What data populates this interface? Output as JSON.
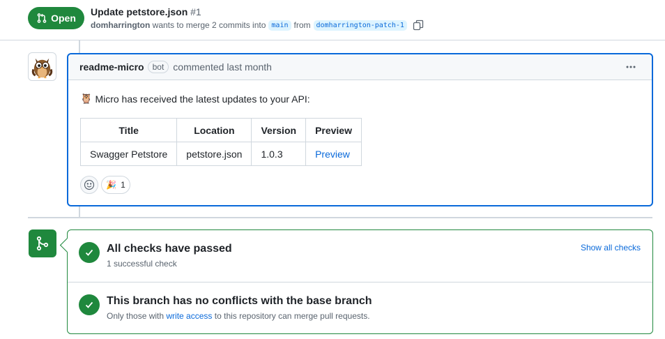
{
  "header": {
    "state_label": "Open",
    "title": "Update petstore.json",
    "number": "#1",
    "author": "domharrington",
    "meta_text": "wants to merge 2 commits into",
    "base_branch": "main",
    "from_text": "from",
    "head_branch": "domharrington-patch-1"
  },
  "comment": {
    "author": "readme-micro",
    "badge": "bot",
    "action": "commented last month",
    "message": "Micro has received the latest updates to your API:",
    "owl_emoji": "🦉",
    "table": {
      "headers": [
        "Title",
        "Location",
        "Version",
        "Preview"
      ],
      "rows": [
        [
          "Swagger Petstore",
          "petstore.json",
          "1.0.3",
          "Preview"
        ]
      ]
    },
    "reactions": {
      "tada_emoji": "🎉",
      "tada_count": "1"
    }
  },
  "merge": {
    "checks_title": "All checks have passed",
    "checks_sub": "1 successful check",
    "show_all": "Show all checks",
    "conflict_title": "This branch has no conflicts with the base branch",
    "conflict_sub_prefix": "Only those with",
    "conflict_link": "write access",
    "conflict_sub_suffix": "to this repository can merge pull requests."
  },
  "colors": {
    "green": "#1f883d",
    "blue": "#0969da",
    "border": "#d0d7de"
  }
}
